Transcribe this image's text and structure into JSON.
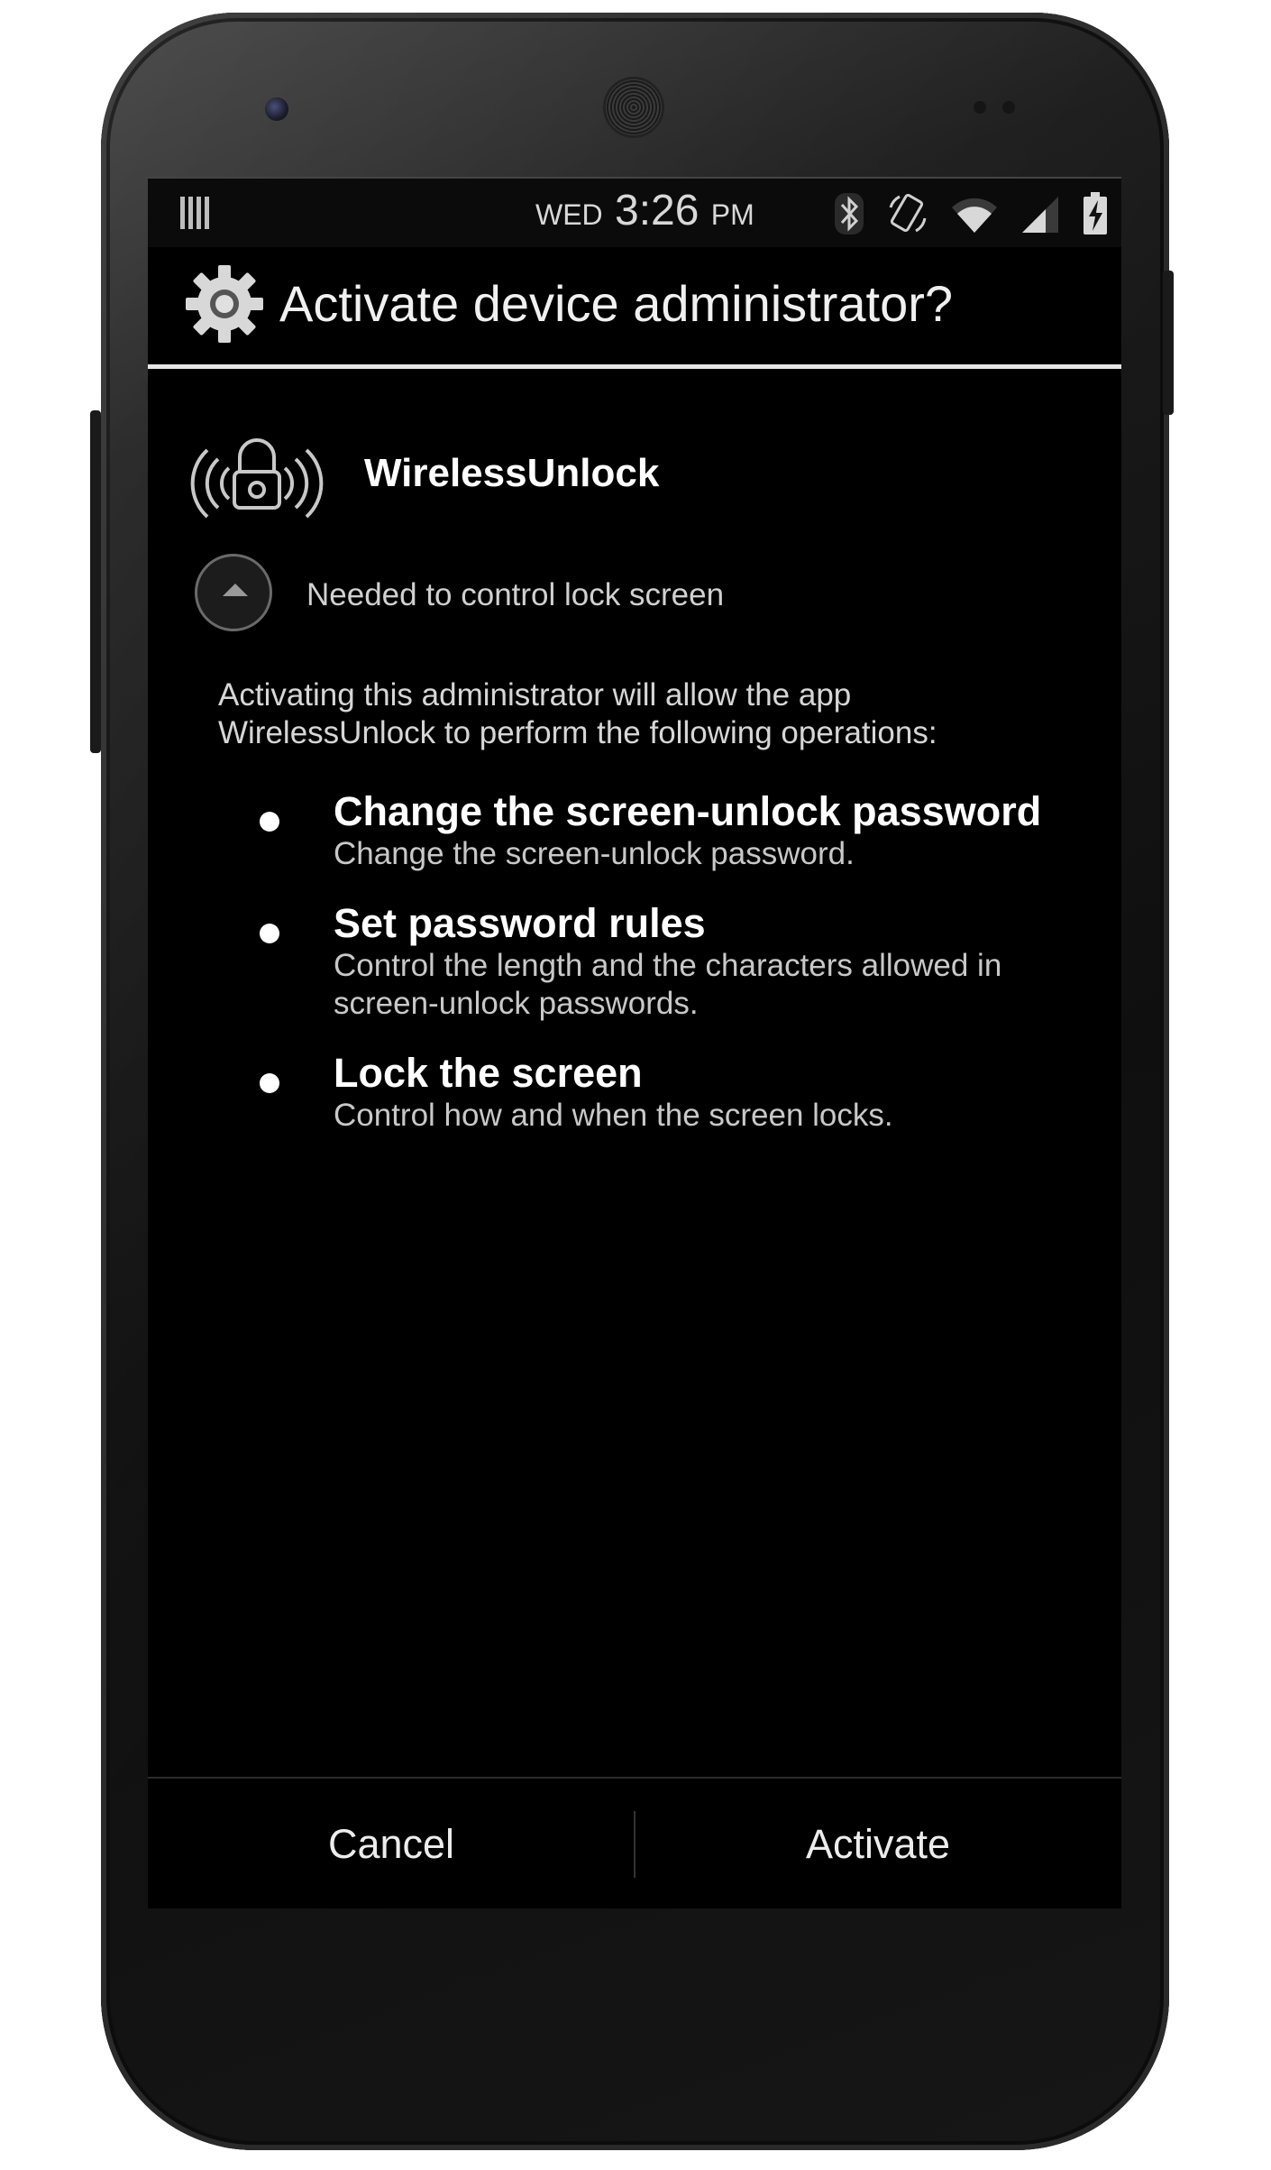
{
  "status_bar": {
    "day": "WED",
    "time": "3:26",
    "ampm": "PM",
    "icons": [
      "barcode-icon",
      "bluetooth-icon",
      "rotation-icon",
      "wifi-icon",
      "signal-icon",
      "battery-charging-icon"
    ]
  },
  "dialog": {
    "title": "Activate device administrator?",
    "title_icon": "gear-icon"
  },
  "app": {
    "name": "WirelessUnlock",
    "description": "Needed to control lock screen",
    "icon": "wireless-lock-icon"
  },
  "warning": {
    "line1": "Activating this administrator will allow the app",
    "line2": "WirelessUnlock to perform the following operations:"
  },
  "policies": [
    {
      "title": "Change the screen-unlock password",
      "desc_line1": "Change the screen-unlock password.",
      "desc_line2": ""
    },
    {
      "title": "Set password rules",
      "desc_line1": "Control the length and the characters allowed in",
      "desc_line2": "screen-unlock passwords."
    },
    {
      "title": "Lock the screen",
      "desc_line1": "Control how and when the screen locks.",
      "desc_line2": ""
    }
  ],
  "buttons": {
    "cancel": "Cancel",
    "activate": "Activate"
  },
  "colors": {
    "background": "#000000",
    "divider": "#e6e6e6",
    "text_primary": "#ffffff",
    "text_secondary": "#c8c8c8"
  }
}
